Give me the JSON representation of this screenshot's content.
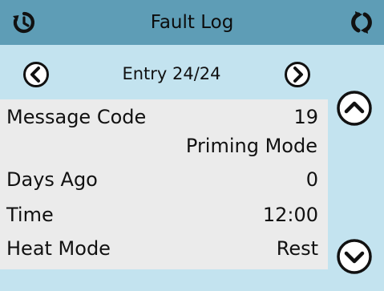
{
  "header": {
    "title": "Fault Log",
    "left_icon": "history-icon",
    "right_icon": "refresh-icon"
  },
  "nav": {
    "entry_label": "Entry 24/24",
    "prev_icon": "chevron-left-circle-icon",
    "next_icon": "chevron-right-circle-icon"
  },
  "scroll": {
    "up_icon": "chevron-up-circle-icon",
    "down_icon": "chevron-down-circle-icon"
  },
  "fault": {
    "message_code_label": "Message Code",
    "message_code_value": "19",
    "message_text": "Priming Mode",
    "days_ago_label": "Days Ago",
    "days_ago_value": "0",
    "time_label": "Time",
    "time_value": "12:00",
    "heat_mode_label": "Heat Mode",
    "heat_mode_value": "Rest"
  },
  "colors": {
    "header": "#5e9db6",
    "background": "#c3e3ef",
    "panel": "#ebebeb"
  }
}
